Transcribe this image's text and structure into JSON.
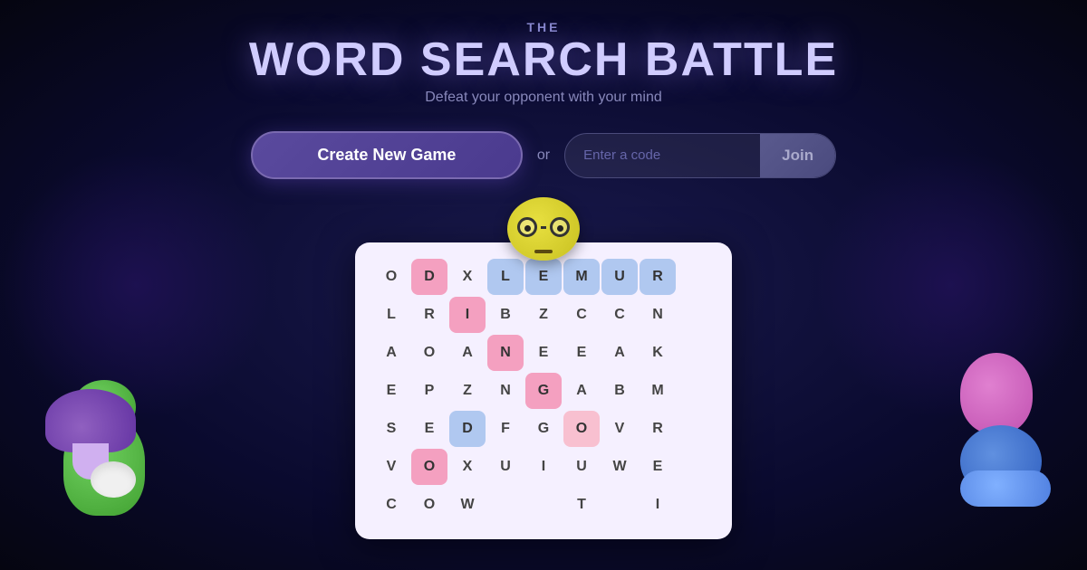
{
  "header": {
    "the_label": "THE",
    "title": "WORD SEARCH BATTLE",
    "subtitle": "Defeat your opponent with your mind"
  },
  "controls": {
    "create_button_label": "Create New Game",
    "or_label": "or",
    "code_input_placeholder": "Enter a code",
    "join_button_label": "Join"
  },
  "grid": {
    "cells": [
      {
        "letter": "O",
        "style": ""
      },
      {
        "letter": "D",
        "style": "highlight-pink"
      },
      {
        "letter": "X",
        "style": ""
      },
      {
        "letter": "L",
        "style": "highlight-blue"
      },
      {
        "letter": "E",
        "style": "highlight-blue"
      },
      {
        "letter": "M",
        "style": "highlight-blue"
      },
      {
        "letter": "U",
        "style": "highlight-blue"
      },
      {
        "letter": "R",
        "style": "highlight-blue"
      },
      {
        "letter": "",
        "style": ""
      },
      {
        "letter": "L",
        "style": ""
      },
      {
        "letter": "R",
        "style": ""
      },
      {
        "letter": "I",
        "style": "highlight-pink"
      },
      {
        "letter": "B",
        "style": ""
      },
      {
        "letter": "Z",
        "style": ""
      },
      {
        "letter": "C",
        "style": ""
      },
      {
        "letter": "C",
        "style": ""
      },
      {
        "letter": "N",
        "style": ""
      },
      {
        "letter": "",
        "style": ""
      },
      {
        "letter": "A",
        "style": ""
      },
      {
        "letter": "O",
        "style": ""
      },
      {
        "letter": "A",
        "style": ""
      },
      {
        "letter": "N",
        "style": "highlight-pink"
      },
      {
        "letter": "E",
        "style": ""
      },
      {
        "letter": "E",
        "style": ""
      },
      {
        "letter": "A",
        "style": ""
      },
      {
        "letter": "K",
        "style": ""
      },
      {
        "letter": "",
        "style": ""
      },
      {
        "letter": "E",
        "style": ""
      },
      {
        "letter": "P",
        "style": ""
      },
      {
        "letter": "Z",
        "style": ""
      },
      {
        "letter": "N",
        "style": ""
      },
      {
        "letter": "G",
        "style": "highlight-pink"
      },
      {
        "letter": "A",
        "style": ""
      },
      {
        "letter": "B",
        "style": ""
      },
      {
        "letter": "M",
        "style": ""
      },
      {
        "letter": "",
        "style": ""
      },
      {
        "letter": "S",
        "style": ""
      },
      {
        "letter": "E",
        "style": ""
      },
      {
        "letter": "D",
        "style": "highlight-blue"
      },
      {
        "letter": "F",
        "style": ""
      },
      {
        "letter": "G",
        "style": ""
      },
      {
        "letter": "O",
        "style": "highlight-pink-light"
      },
      {
        "letter": "V",
        "style": ""
      },
      {
        "letter": "R",
        "style": ""
      },
      {
        "letter": "",
        "style": ""
      },
      {
        "letter": "V",
        "style": ""
      },
      {
        "letter": "O",
        "style": "highlight-pink"
      },
      {
        "letter": "X",
        "style": ""
      },
      {
        "letter": "U",
        "style": ""
      },
      {
        "letter": "I",
        "style": ""
      },
      {
        "letter": "U",
        "style": ""
      },
      {
        "letter": "W",
        "style": ""
      },
      {
        "letter": "E",
        "style": ""
      },
      {
        "letter": "",
        "style": ""
      },
      {
        "letter": "C",
        "style": ""
      },
      {
        "letter": "O",
        "style": ""
      },
      {
        "letter": "W",
        "style": ""
      },
      {
        "letter": "",
        "style": ""
      },
      {
        "letter": "",
        "style": ""
      },
      {
        "letter": "T",
        "style": ""
      },
      {
        "letter": "",
        "style": ""
      },
      {
        "letter": "I",
        "style": ""
      },
      {
        "letter": "",
        "style": ""
      }
    ]
  }
}
